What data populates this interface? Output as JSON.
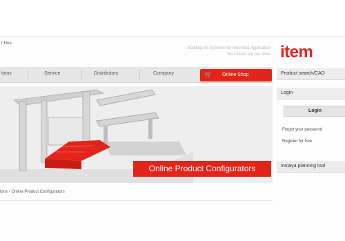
{
  "header": {
    "page_link": "r Hea",
    "tagline_line1": "Building Kit Systems for Industrial Application",
    "tagline_line2": "Your ideas are our drive",
    "logo": "item"
  },
  "nav": {
    "items": [
      "tions",
      "Service",
      "Distributors",
      "Company"
    ],
    "shop_label": "Online Shop"
  },
  "hero": {
    "banner_text": "Online Product Configurators"
  },
  "breadcrumb": "ions › Online Product Configurators",
  "sidebar": {
    "product_search_label": "Product search/CAD",
    "login_header": "Login",
    "login_button": "Login",
    "forgot_password": "Forgot your password",
    "register": "Register for free",
    "tool_label": "Instaya planning tool"
  },
  "colors": {
    "brand_red": "#e3241b"
  }
}
